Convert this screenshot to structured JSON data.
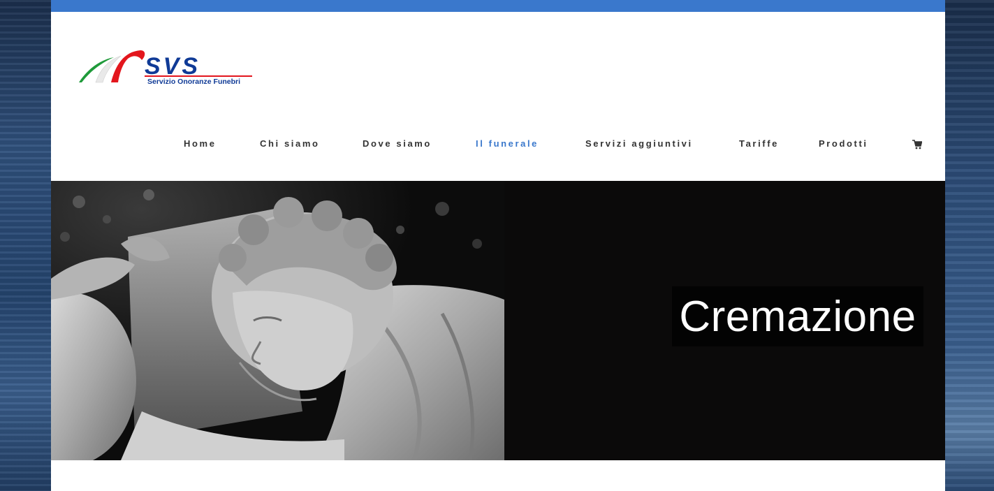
{
  "site": {
    "logo_text": "SVS",
    "logo_tagline": "Servizio Onoranze Funebri",
    "accent_color": "#3a78cc",
    "logo_red": "#e3161d",
    "logo_blue": "#0f3a96",
    "logo_green": "#1f9a3a"
  },
  "nav": {
    "items": [
      {
        "label": "Home"
      },
      {
        "label": "Chi siamo"
      },
      {
        "label": "Dove siamo"
      },
      {
        "label": "Il funerale",
        "active": true
      },
      {
        "label": "Servizi aggiuntivi"
      },
      {
        "label": "Tariffe"
      },
      {
        "label": "Prodotti"
      }
    ],
    "cart_icon": "shopping-cart-icon"
  },
  "hero": {
    "title": "Cremazione",
    "image": "marble-cherub-statue-photo"
  }
}
